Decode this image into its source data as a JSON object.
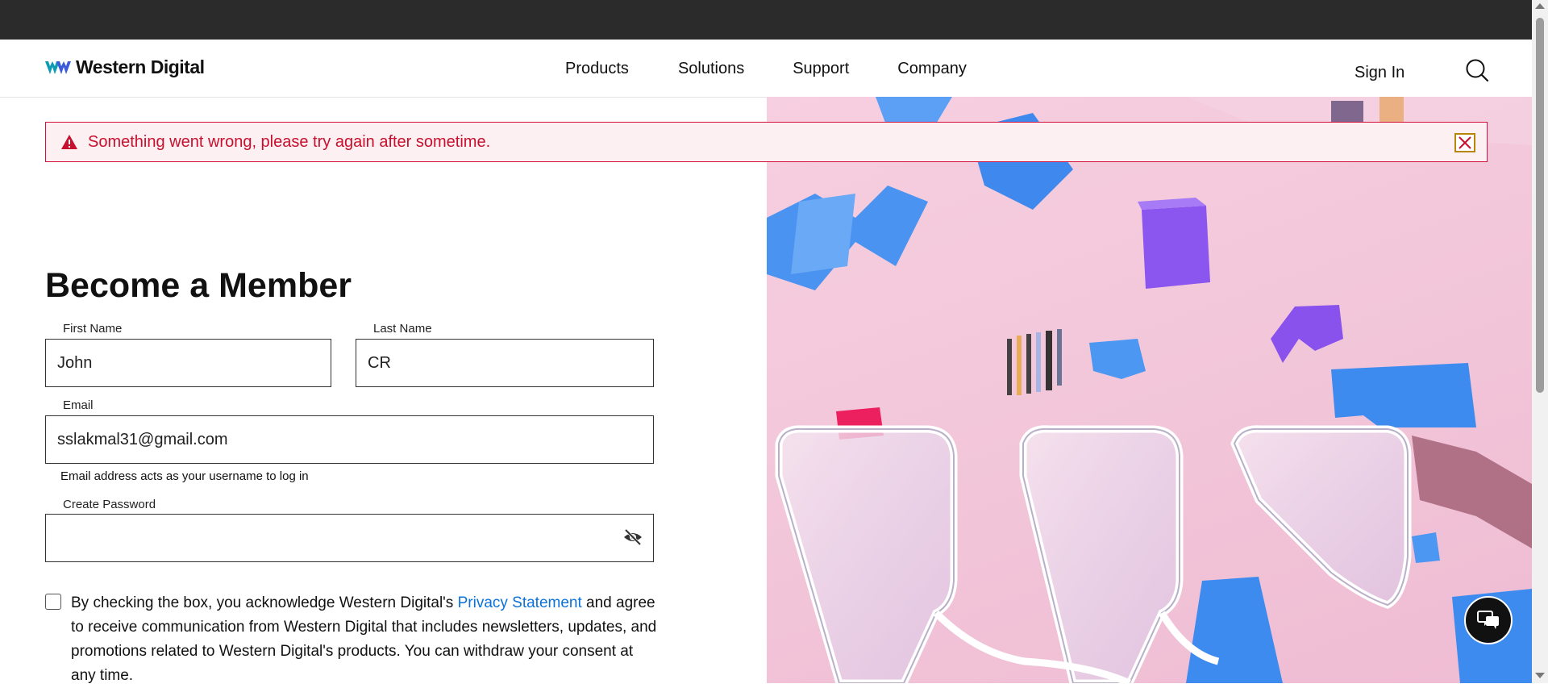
{
  "header": {
    "logo_text": "Western Digital",
    "nav": [
      "Products",
      "Solutions",
      "Support",
      "Company"
    ],
    "signin_label": "Sign In"
  },
  "alert": {
    "message": "Something went wrong, please try again after sometime."
  },
  "form": {
    "title": "Become a Member",
    "first_name": {
      "label": "First Name",
      "value": "John"
    },
    "last_name": {
      "label": "Last Name",
      "value": "CR"
    },
    "email": {
      "label": "Email",
      "value": "sslakmal31@gmail.com",
      "helper": "Email address acts as your username to log in"
    },
    "password": {
      "label": "Create Password",
      "value": ""
    },
    "consent": {
      "prefix": "By checking the box, you acknowledge Western Digital's ",
      "link": "Privacy Statement",
      "suffix": " and agree to receive communication from Western Digital that includes newsletters, updates, and promotions related to Western Digital's products. You can withdraw your consent at any time."
    }
  },
  "colors": {
    "alert_red": "#c8102e",
    "link_blue": "#0b72d8",
    "hero_pink": "#f3c7da",
    "hero_blue": "#3f8df0",
    "hero_purple": "#8b56ef",
    "topbar": "#2b2b2b"
  },
  "icons": [
    "warning-icon",
    "close-icon",
    "search-icon",
    "eye-slash-icon",
    "chat-icon",
    "wd-logo-icon"
  ]
}
